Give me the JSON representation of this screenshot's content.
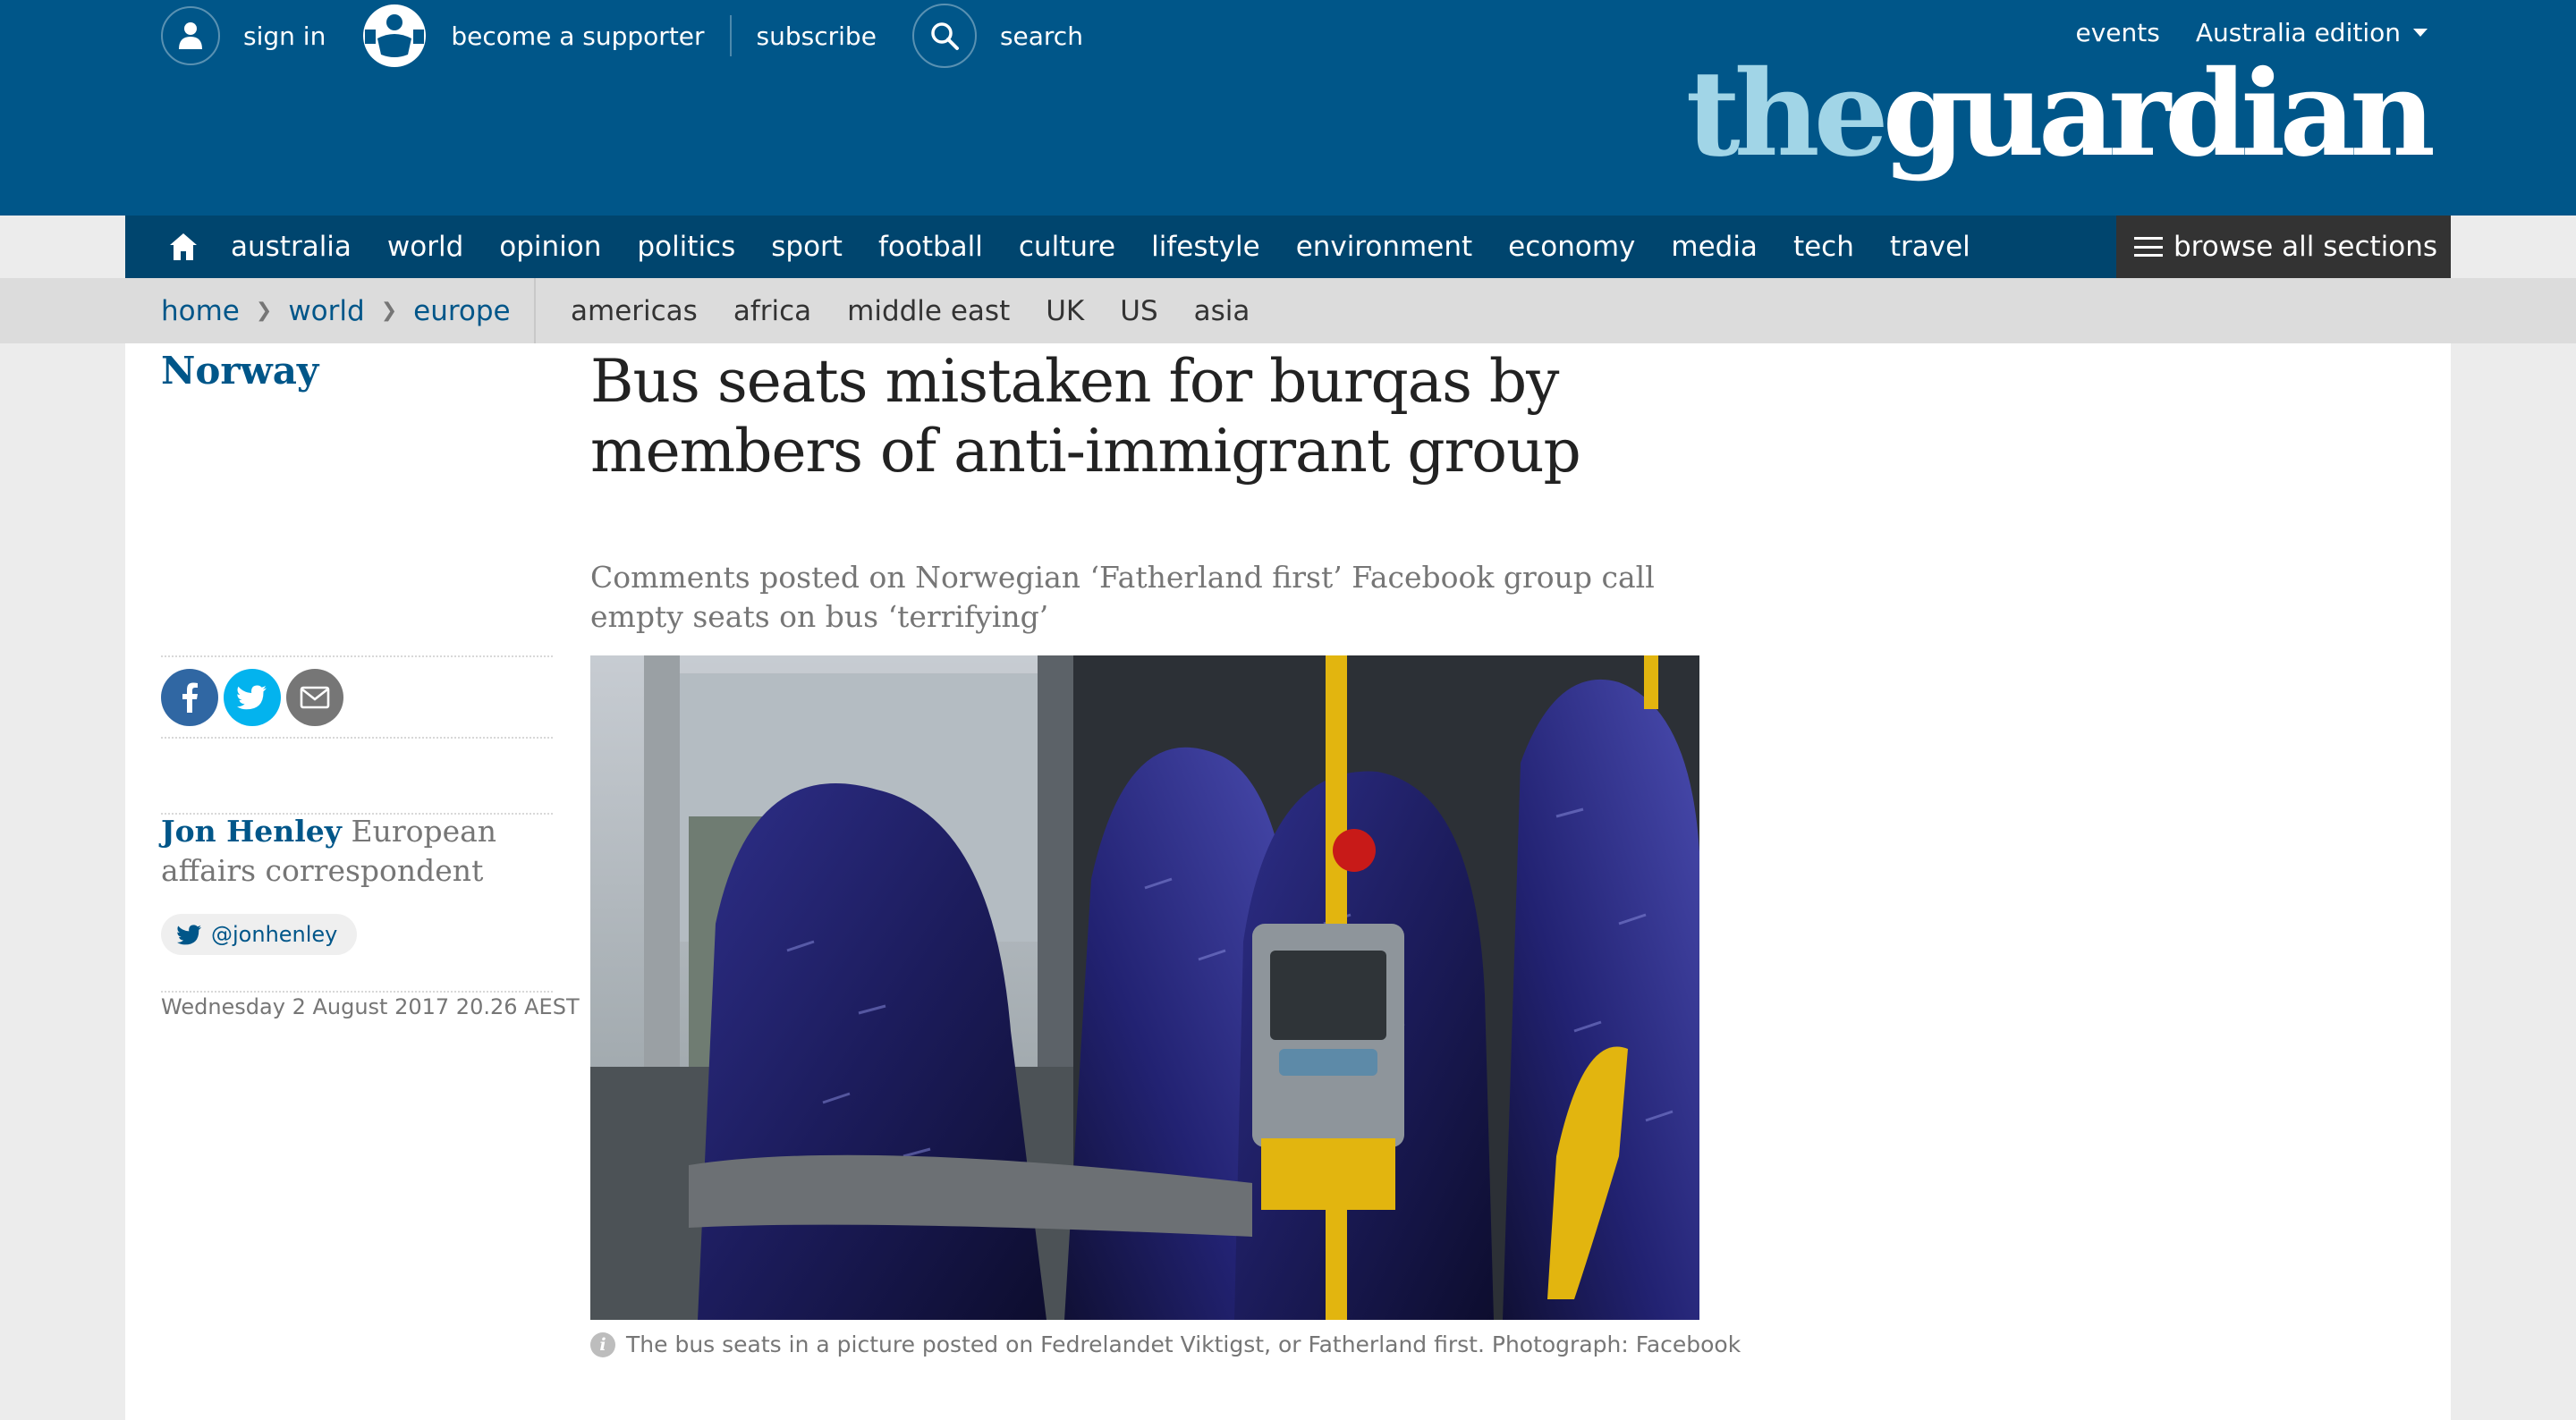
{
  "header": {
    "sign_in": "sign in",
    "become_supporter": "become a supporter",
    "subscribe": "subscribe",
    "search": "search",
    "events": "events",
    "edition": "Australia edition",
    "logo_the": "the",
    "logo_guardian": "guardian"
  },
  "nav": {
    "items": [
      "australia",
      "world",
      "opinion",
      "politics",
      "sport",
      "football",
      "culture",
      "lifestyle",
      "environment",
      "economy",
      "media",
      "tech",
      "travel"
    ],
    "browse": "browse all sections"
  },
  "subnav": {
    "breadcrumbs": [
      "home",
      "world",
      "europe"
    ],
    "links": [
      "americas",
      "africa",
      "middle east",
      "UK",
      "US",
      "asia"
    ]
  },
  "article": {
    "section": "Norway",
    "headline": "Bus seats mistaken for burqas by members of anti-immigrant group",
    "standfirst": "Comments posted on Norwegian ‘Fatherland first’ Facebook group call empty seats on bus ‘terrifying’",
    "author_name": "Jon Henley",
    "author_role": "European affairs correspondent",
    "twitter_handle": "@jonhenley",
    "date": "Wednesday 2 August 2017 20.26 AEST",
    "caption": "The bus seats in a picture posted on Fedrelandet Viktigst, or Fatherland first. Photograph: Facebook"
  },
  "colors": {
    "brand_blue": "#005689",
    "nav_blue": "#00456e",
    "logo_light": "#a1d5e7",
    "facebook": "#3067a3",
    "twitter": "#03b3ee"
  }
}
